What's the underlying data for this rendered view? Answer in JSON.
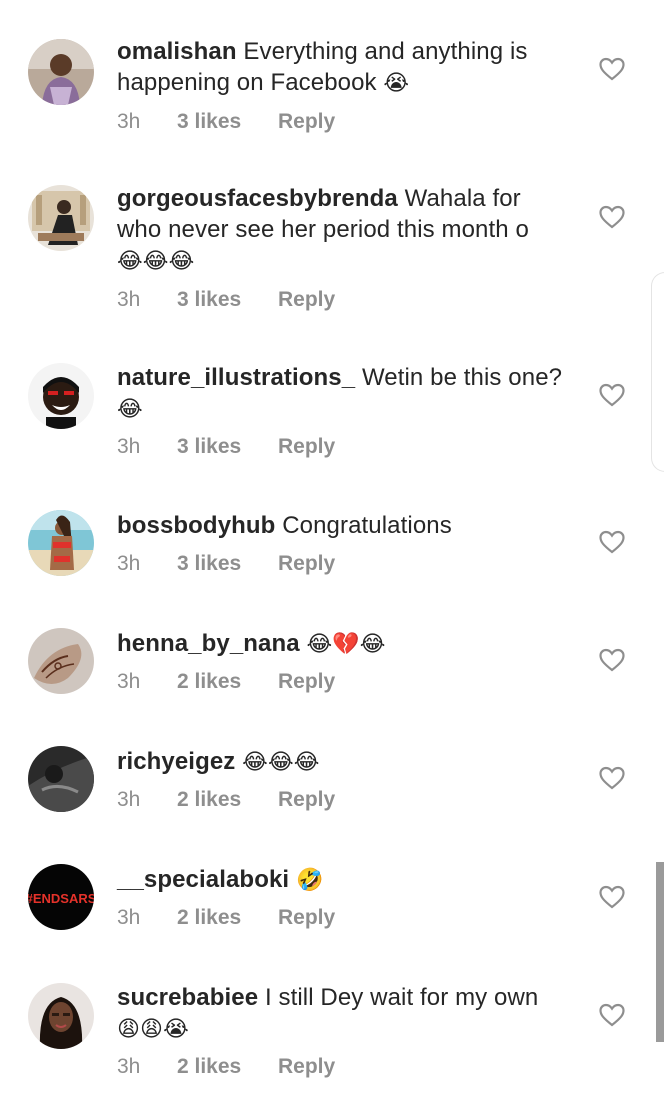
{
  "comments": [
    {
      "username": "omalishan",
      "text_line1": " Everything and anything is",
      "text_line2": "happening on Facebook ",
      "emoji": "😭",
      "time": "3h",
      "likes": "3 likes",
      "reply": "Reply"
    },
    {
      "username": "gorgeousfacesbybrenda",
      "text_line1": " Wahala for",
      "text_line2": "who never see her period this month o",
      "emoji": "😂😂😂",
      "time": "3h",
      "likes": "3 likes",
      "reply": "Reply"
    },
    {
      "username": "nature_illustrations_",
      "text_line1": " Wetin be this one?",
      "emoji": "😂",
      "time": "3h",
      "likes": "3 likes",
      "reply": "Reply"
    },
    {
      "username": "bossbodyhub",
      "text_line1": " Congratulations",
      "time": "3h",
      "likes": "3 likes",
      "reply": "Reply"
    },
    {
      "username": "henna_by_nana",
      "text_line1": " ",
      "emoji": "😂💔😂",
      "time": "3h",
      "likes": "2 likes",
      "reply": "Reply"
    },
    {
      "username": "richyeigez",
      "text_line1": " ",
      "emoji": "😂😂😂",
      "time": "3h",
      "likes": "2 likes",
      "reply": "Reply"
    },
    {
      "username": "__specialaboki",
      "text_line1": " ",
      "emoji": "🤣",
      "avatar_text": "#ENDSARS",
      "time": "3h",
      "likes": "2 likes",
      "reply": "Reply"
    },
    {
      "username": "sucrebabiee",
      "text_line1": " I still Dey wait for my own",
      "emoji": "😩😩😭",
      "time": "3h",
      "likes": "2 likes",
      "reply": "Reply"
    }
  ],
  "icons": {
    "like": "heart-outline-icon"
  },
  "colors": {
    "text": "#262626",
    "meta": "#8e8e8e"
  }
}
